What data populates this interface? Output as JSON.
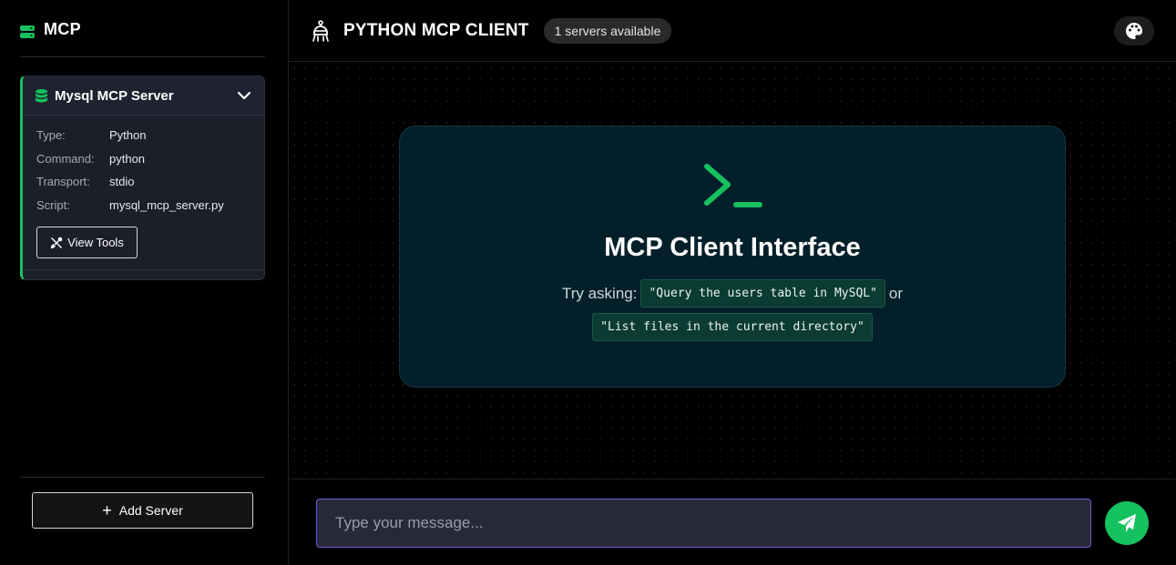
{
  "sidebar": {
    "title": "MCP",
    "server": {
      "name": "Mysql MCP Server",
      "details": [
        {
          "key": "Type:",
          "value": "Python"
        },
        {
          "key": "Command:",
          "value": "python"
        },
        {
          "key": "Transport:",
          "value": "stdio"
        },
        {
          "key": "Script:",
          "value": "mysql_mcp_server.py"
        }
      ],
      "view_tools_label": "View Tools"
    },
    "add_server_label": "Add Server"
  },
  "header": {
    "title": "PYTHON MCP CLIENT",
    "badge": "1 servers available"
  },
  "welcome": {
    "title": "MCP Client Interface",
    "try_asking": "Try asking:",
    "example1": "\"Query the users table in MySQL\"",
    "or": "or",
    "example2": "\"List files in the current directory\""
  },
  "composer": {
    "placeholder": "Type your message..."
  },
  "colors": {
    "accent": "#16c15f",
    "input_border": "#6b5bd6",
    "card_bg": "#03202a"
  },
  "icons": {
    "logo": "server-icon",
    "db": "database-icon",
    "chevron": "chevron-down-icon",
    "tools": "tools-icon",
    "bot": "robot-icon",
    "theme": "palette-icon",
    "terminal": "terminal-icon",
    "send": "send-icon"
  }
}
